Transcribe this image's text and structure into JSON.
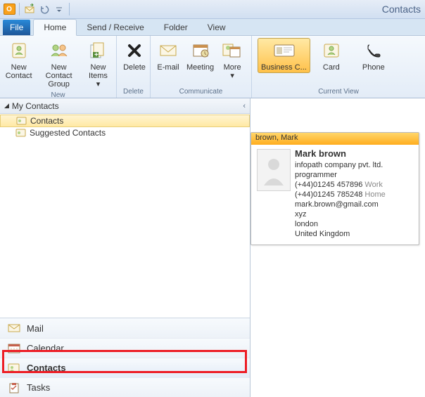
{
  "title": "Contacts",
  "tabs": {
    "file": "File",
    "home": "Home",
    "sendreceive": "Send / Receive",
    "folder": "Folder",
    "view": "View"
  },
  "ribbon": {
    "new": {
      "label": "New",
      "new_contact": "New\nContact",
      "new_contact_group": "New Contact\nGroup",
      "new_items": "New\nItems"
    },
    "delete": {
      "label": "Delete",
      "delete_btn": "Delete"
    },
    "communicate": {
      "label": "Communicate",
      "email": "E-mail",
      "meeting": "Meeting",
      "more": "More"
    },
    "currentview": {
      "label": "Current View",
      "business_card": "Business C...",
      "card": "Card",
      "phone": "Phone"
    }
  },
  "sidebar": {
    "header": "My Contacts",
    "items": [
      {
        "label": "Contacts"
      },
      {
        "label": "Suggested Contacts"
      }
    ]
  },
  "nav": {
    "mail": "Mail",
    "calendar": "Calendar",
    "contacts": "Contacts",
    "tasks": "Tasks"
  },
  "card": {
    "header": "brown, Mark",
    "name": "Mark brown",
    "company": "infopath company pvt. ltd.",
    "title": "programmer",
    "phone_work": "(+44)01245 457896",
    "phone_work_label": "Work",
    "phone_home": "(+44)01245 785248",
    "phone_home_label": "Home",
    "email": "mark.brown@gmail.com",
    "addr1": "xyz",
    "addr2": "london",
    "addr3": "United Kingdom"
  }
}
